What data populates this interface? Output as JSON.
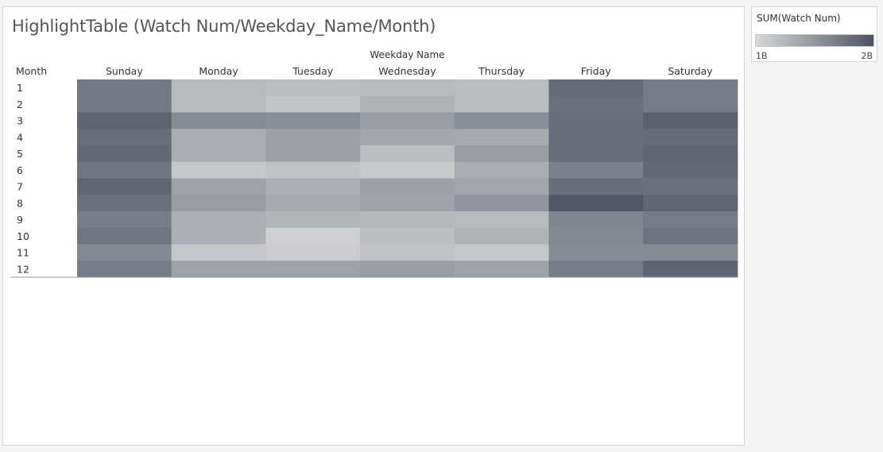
{
  "colors": {
    "low": "#d7d7d7",
    "high": "#4c5362",
    "axis_line": "#999999",
    "text": "#333333"
  },
  "chart_data": {
    "type": "heatmap",
    "title": "HighlightTable (Watch Num/Weekday_Name/Month)",
    "column_group_label": "Weekday Name",
    "row_header_label": "Month",
    "columns": [
      "Sunday",
      "Monday",
      "Tuesday",
      "Wednesday",
      "Thursday",
      "Friday",
      "Saturday"
    ],
    "rows": [
      "1",
      "2",
      "3",
      "4",
      "5",
      "6",
      "7",
      "8",
      "9",
      "10",
      "11",
      "12"
    ],
    "measure": "SUM(Watch Num)",
    "value_unit": "billions",
    "scale_range": [
      1.0,
      2.0
    ],
    "values": [
      [
        1.72,
        1.22,
        1.2,
        1.22,
        1.2,
        1.82,
        1.7
      ],
      [
        1.72,
        1.22,
        1.14,
        1.28,
        1.2,
        1.78,
        1.7
      ],
      [
        1.88,
        1.58,
        1.56,
        1.44,
        1.56,
        1.8,
        1.9
      ],
      [
        1.8,
        1.32,
        1.42,
        1.36,
        1.34,
        1.8,
        1.82
      ],
      [
        1.84,
        1.32,
        1.42,
        1.2,
        1.44,
        1.8,
        1.86
      ],
      [
        1.74,
        1.12,
        1.16,
        1.1,
        1.32,
        1.66,
        1.84
      ],
      [
        1.86,
        1.4,
        1.3,
        1.42,
        1.38,
        1.8,
        1.78
      ],
      [
        1.78,
        1.44,
        1.34,
        1.4,
        1.5,
        1.96,
        1.86
      ],
      [
        1.68,
        1.3,
        1.26,
        1.24,
        1.22,
        1.62,
        1.7
      ],
      [
        1.74,
        1.3,
        1.06,
        1.2,
        1.28,
        1.6,
        1.76
      ],
      [
        1.6,
        1.12,
        1.08,
        1.16,
        1.12,
        1.58,
        1.58
      ],
      [
        1.7,
        1.4,
        1.4,
        1.44,
        1.4,
        1.7,
        1.88
      ]
    ]
  },
  "legend": {
    "title": "SUM(Watch Num)",
    "min_label": "1B",
    "max_label": "2B"
  }
}
